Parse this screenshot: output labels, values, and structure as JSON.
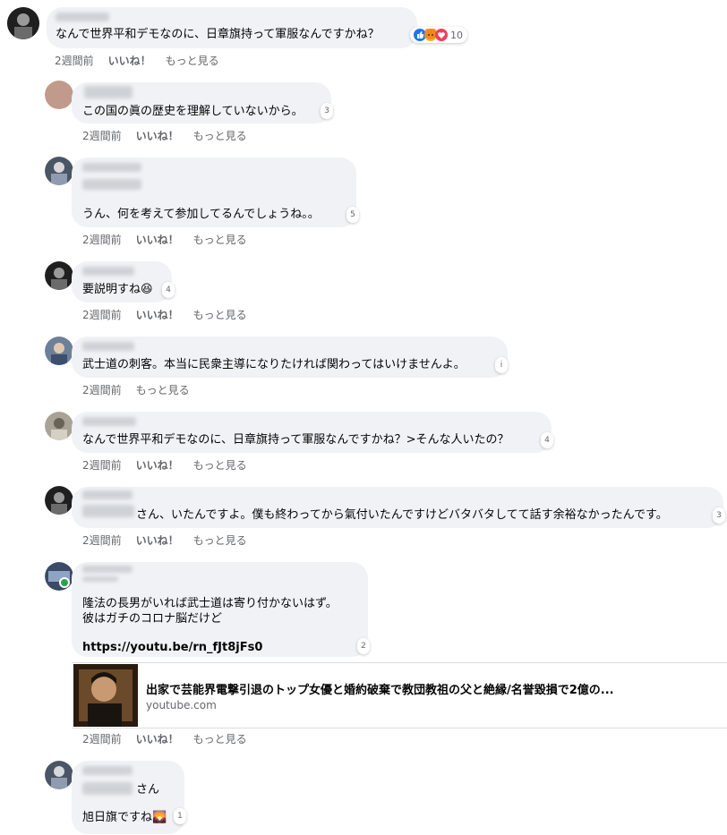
{
  "comments": [
    {
      "text": "なんで世界平和デモなのに、日章旗持って軍服なんですかね？",
      "reaction_count": "10",
      "time": "2週間前",
      "like": "いいね！",
      "more": "もっと見る"
    },
    {
      "text": "この国の眞の歴史を理解していないから。",
      "reaction_count": "3",
      "time": "2週間前",
      "like": "いいね！",
      "more": "もっと見る"
    },
    {
      "text": "うん、何を考えて参加してるんでしょうね。。",
      "reaction_count": "5",
      "time": "2週間前",
      "like": "いいね！",
      "more": "もっと見る"
    },
    {
      "text": "要説明すね😆",
      "reaction_count": "4",
      "time": "2週間前",
      "like": "いいね！",
      "more": "もっと見る"
    },
    {
      "text": "武士道の刺客。本当に民衆主導になりたければ関わってはいけませんよ。",
      "reaction_count": "i",
      "time": "2週間前",
      "more": "もっと見る"
    },
    {
      "text": "なんで世界平和デモなのに、日章旗持って軍服なんですかね？>そんな人いたの？",
      "reaction_count": "4",
      "time": "2週間前",
      "like": "いいね！",
      "more": "もっと見る"
    },
    {
      "text": "さん、いたんですよ。僕も終わってから氣付いたんですけどバタバタしてて話す余裕なかったんです。",
      "reaction_count": "3",
      "time": "2週間前",
      "like": "いいね！",
      "more": "もっと見る"
    },
    {
      "line1": "隆法の長男がいれば武士道は寄り付かないはず。",
      "line2": "彼はガチのコロナ脳だけど",
      "link": "https://youtu.be/rn_fJt8jFs0",
      "reaction_count": "2",
      "time": "2週間前",
      "like": "いいね！",
      "more": "もっと見る",
      "preview": {
        "title": "出家で芸能界電撃引退のトップ女優と婚約破棄で教団教祖の父と絶縁/名誉毀損で2億の...",
        "domain": "youtube.com"
      }
    },
    {
      "line1": "さん",
      "line2": "旭日旗ですね🌄",
      "reaction_count": "1"
    }
  ],
  "colors": {
    "bubble": "#f0f2f5",
    "meta": "#65676b",
    "like_blue": "#1877f2",
    "angry_orange": "#f7b125",
    "care_red": "#f33e58",
    "online": "#31a24c"
  },
  "icons": [
    "like-reaction-icon",
    "angry-reaction-icon",
    "care-reaction-icon"
  ]
}
